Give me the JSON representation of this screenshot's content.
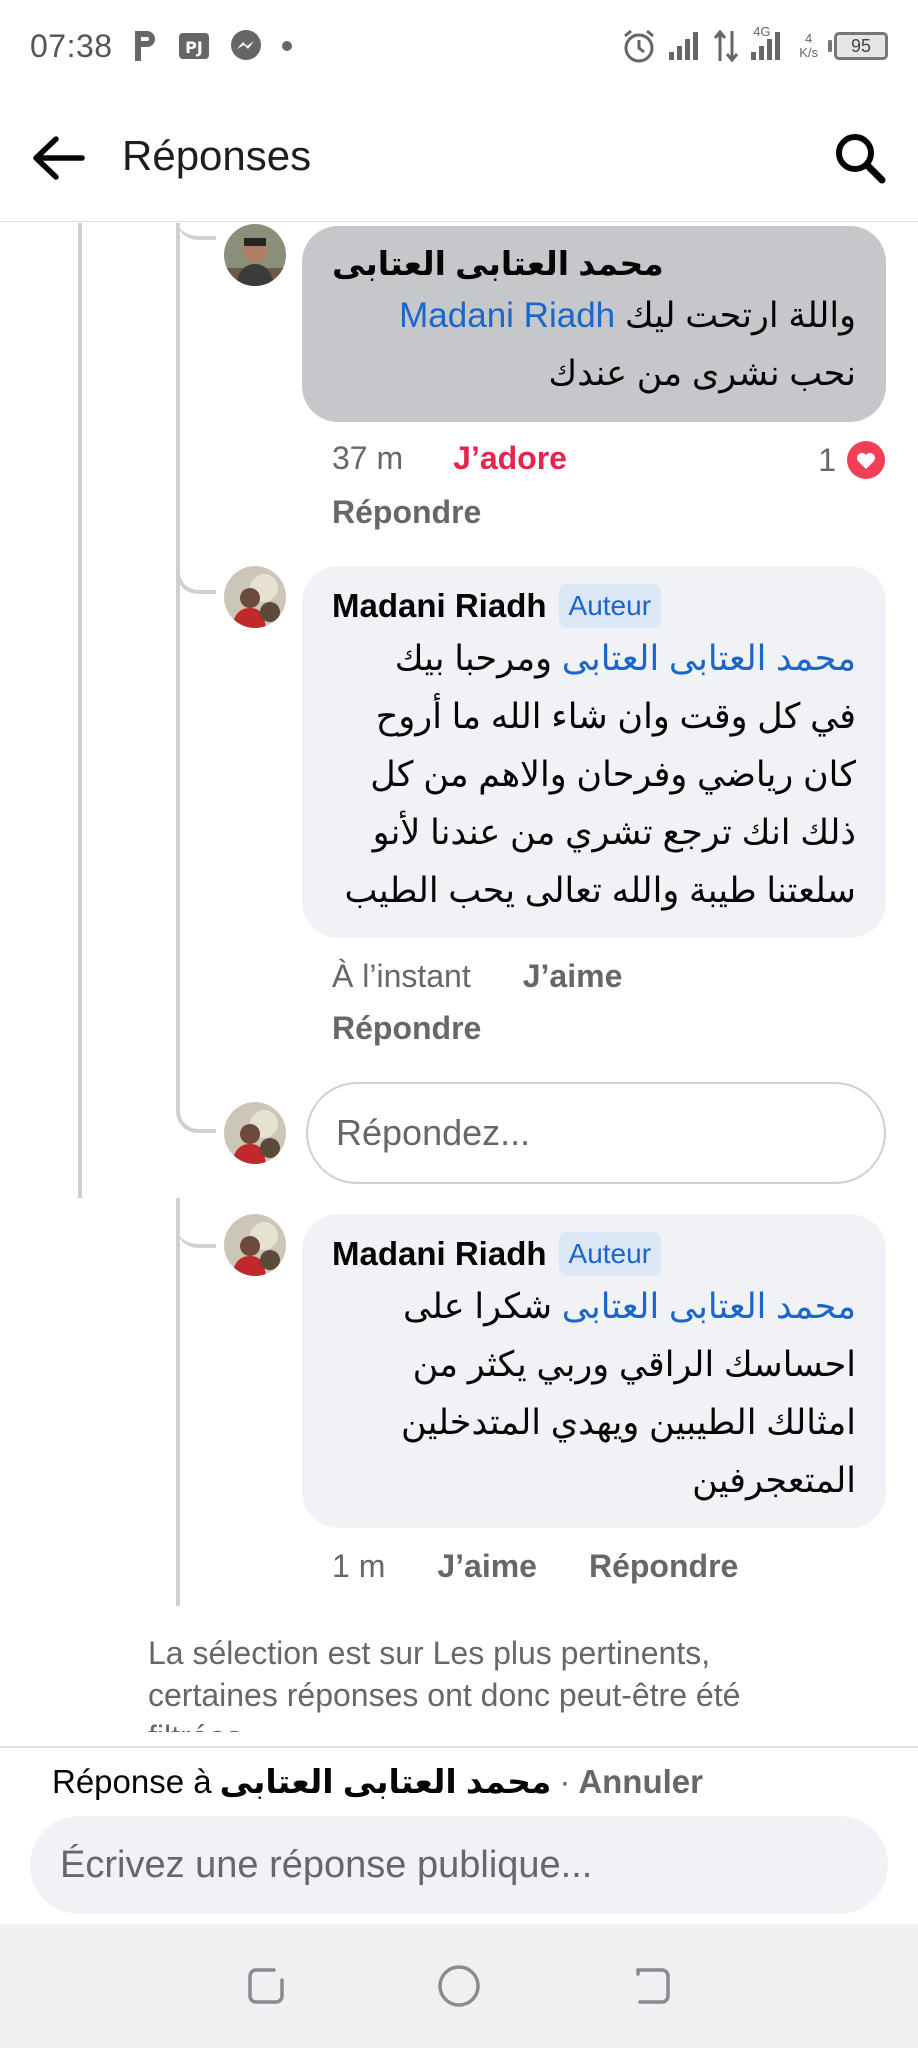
{
  "status_bar": {
    "time": "07:38",
    "network_top": "4",
    "network_bottom": "K/s",
    "signal_label": "4G",
    "battery": "95"
  },
  "header": {
    "title": "Réponses"
  },
  "comments": [
    {
      "author": "محمد العتابى العتابى",
      "text_mention": "Madani Riadh",
      "text_line1_rest": "واللة ارتحت ليك",
      "text_line2": "نحب نشرى من عندك",
      "time": "37 m",
      "like_label": "J’adore",
      "reply_label": "Répondre",
      "reaction_count": "1"
    },
    {
      "author": "Madani Riadh",
      "badge": "Auteur",
      "text_mention": "محمد العتابى العتابى",
      "text_line1_rest": "ومرحبا بيك",
      "text_line2": "في كل وقت وان شاء الله ما أروح",
      "text_line3": "كان رياضي وفرحان والاهم من كل",
      "text_line4": "ذلك انك ترجع تشري من عندنا لأنو",
      "text_line5": "سلعتنا طيبة والله تعالى يحب الطيب",
      "time": "À l’instant",
      "like_label": "J’aime",
      "reply_label": "Répondre"
    },
    {
      "author": "Madani Riadh",
      "badge": "Auteur",
      "text_mention": "محمد العتابى العتابى",
      "text_line1_rest": "شكرا على",
      "text_line2": "احساسك الراقي وربي يكثر من",
      "text_line3": "امثالك الطيبين ويهدي المتدخلين",
      "text_line4": "المتعجرفين",
      "time": "1 m",
      "like_label": "J’aime",
      "reply_label": "Répondre"
    }
  ],
  "inline_reply": {
    "placeholder": "Répondez..."
  },
  "filter_note": "La sélection est sur Les plus pertinents, certaines réponses ont donc peut-être été filtrées.",
  "footer": {
    "replying_prefix": "Réponse à",
    "replying_name": "محمد العتابى العتابى",
    "separator": "·",
    "cancel": "Annuler",
    "compose_placeholder": "Écrivez une réponse publique..."
  },
  "colors": {
    "mention": "#1a66c9",
    "love": "#e5254b",
    "bubble_highlight": "#c6c7cb",
    "bubble": "#f0f2f5"
  }
}
